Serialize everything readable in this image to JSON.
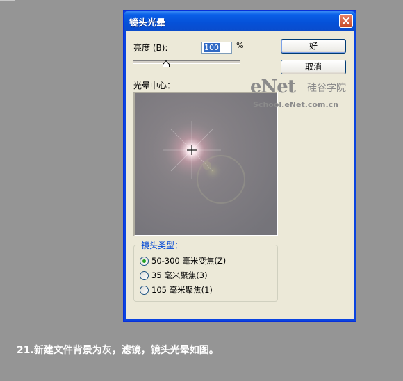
{
  "dialog": {
    "title": "镜头光晕",
    "brightness_label": "亮度 (B):",
    "brightness_value": "100",
    "percent_sign": "%",
    "brightness_percent": 100,
    "ok_label": "好",
    "cancel_label": "取消",
    "flare_center_label": "光晕中心：",
    "lens_type_title": "镜头类型：",
    "lens_options": [
      {
        "label": "50-300 毫米变焦(Z)",
        "selected": true
      },
      {
        "label": "35 毫米聚焦(3)",
        "selected": false
      },
      {
        "label": "105 毫米聚焦(1)",
        "selected": false
      }
    ]
  },
  "watermark": {
    "brand": "eNet",
    "brand_cn": "硅谷学院",
    "url": "School.eNet.com.cn"
  },
  "caption": "21.新建文件背景为灰，滤镜，镜头光晕如图。",
  "colors": {
    "background": "#959595",
    "titlebar": "#0551d8",
    "dialog": "#ece9d8",
    "radio_selected": "#21a121"
  }
}
